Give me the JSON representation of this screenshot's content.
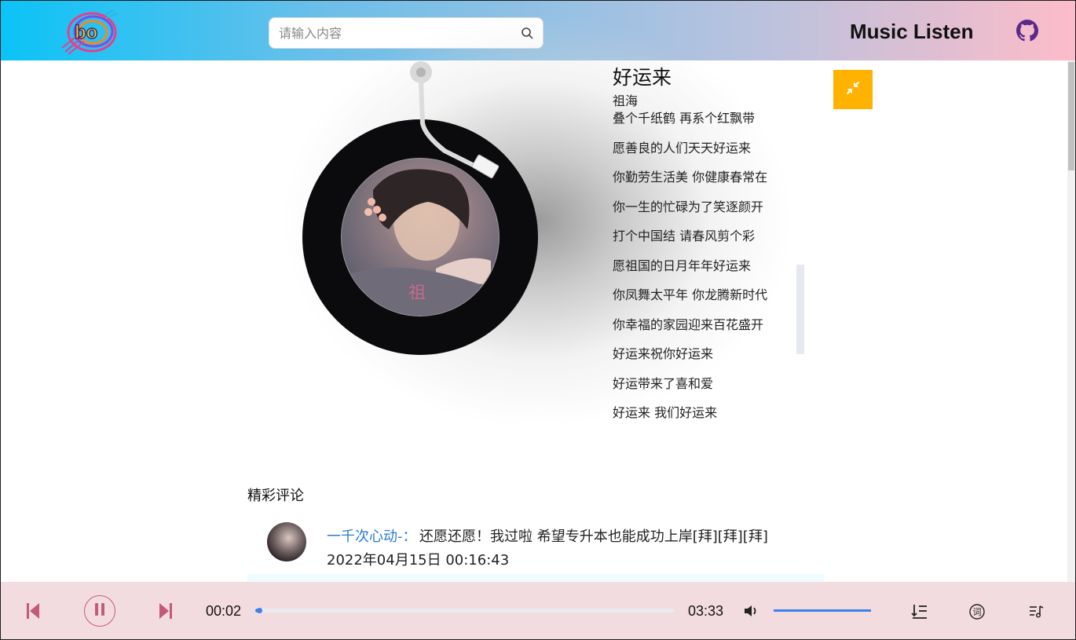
{
  "header": {
    "search_placeholder": "请输入内容",
    "app_title": "Music Listen",
    "logo_text": "bo"
  },
  "song": {
    "title": "好运来",
    "artist": "祖海",
    "lyrics": [
      "叠个千纸鹤 再系个红飘带",
      "愿善良的人们天天好运来",
      "你勤劳生活美 你健康春常在",
      "你一生的忙碌为了笑逐颜开",
      "打个中国结 请春风剪个彩",
      "愿祖国的日月年年好运来",
      "你凤舞太平年 你龙腾新时代",
      "你幸福的家园迎来百花盛开",
      "好运来祝你好运来",
      "好运带来了喜和爱",
      "好运来 我们好运来"
    ]
  },
  "comments": {
    "title": "精彩评论",
    "items": [
      {
        "user": "一千次心动-：",
        "text": "还愿还愿！我过啦 希望专升本也能成功上岸[拜][拜][拜]",
        "time": "2022年04月15日 00:16:43"
      }
    ]
  },
  "player": {
    "current_time": "00:02",
    "total_time": "03:33",
    "progress": 0.01,
    "volume": 1.0,
    "icons": {
      "prev": "skip-previous-icon",
      "play_state": "pause-icon",
      "next": "skip-next-icon",
      "volume": "volume-icon",
      "order": "list-order-icon",
      "lyric": "lyric-icon",
      "playlist": "playlist-icon"
    }
  },
  "colors": {
    "accent": "#3c82e8",
    "shrink_button": "#ffb300",
    "playbar_bg": "#f3dce0",
    "control_pink": "#c25b7a",
    "comment_user": "#2a7bd4"
  }
}
